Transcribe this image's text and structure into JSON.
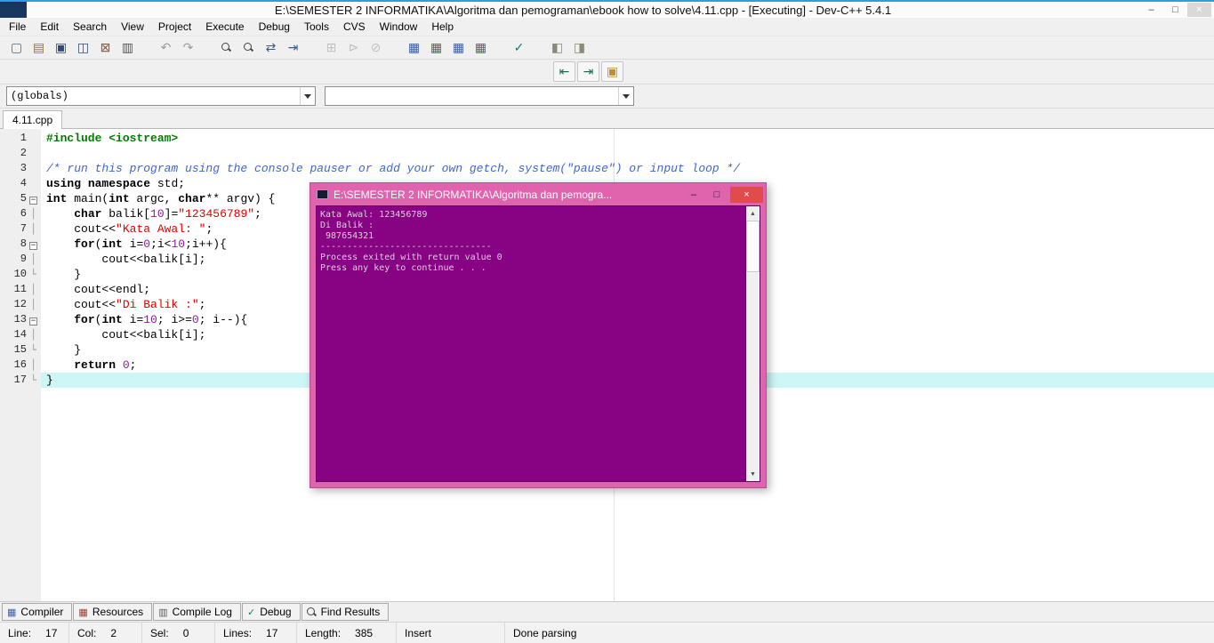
{
  "accent": {
    "top_strip": "#2ba0e0",
    "app_block": "#17375e"
  },
  "window": {
    "title": "E:\\SEMESTER 2 INFORMATIKA\\Algoritma dan pemograman\\ebook how to solve\\4.11.cpp - [Executing] - Dev-C++ 5.4.1",
    "minimize": "–",
    "maximize": "□",
    "close": "×"
  },
  "menubar": {
    "items": [
      "File",
      "Edit",
      "Search",
      "View",
      "Project",
      "Execute",
      "Debug",
      "Tools",
      "CVS",
      "Window",
      "Help"
    ]
  },
  "toolbar_main": {
    "groups": [
      [
        {
          "name": "new-file-icon",
          "glyph": "▢",
          "color": "#4a6a8a"
        },
        {
          "name": "open-file-icon",
          "glyph": "▤",
          "color": "#8a7a3a"
        },
        {
          "name": "save-icon",
          "glyph": "▣",
          "color": "#2e4a7a"
        },
        {
          "name": "save-all-icon",
          "glyph": "◫",
          "color": "#2e4a7a"
        },
        {
          "name": "close-file-icon",
          "glyph": "⊠",
          "color": "#7a5a4a"
        },
        {
          "name": "print-icon",
          "glyph": "▥",
          "color": "#555555"
        }
      ],
      [
        {
          "name": "undo-icon",
          "glyph": "↶",
          "color": "#9a9a9a"
        },
        {
          "name": "redo-icon",
          "glyph": "↷",
          "color": "#9a9a9a"
        }
      ],
      [
        {
          "name": "find-icon",
          "glyph": "MAG",
          "color": "#444444"
        },
        {
          "name": "find-in-files-icon",
          "glyph": "MAG",
          "color": "#444444"
        },
        {
          "name": "replace-icon",
          "glyph": "⇄",
          "color": "#3a5a8a"
        },
        {
          "name": "goto-line-icon",
          "glyph": "⇥",
          "color": "#3a5a8a"
        }
      ],
      [
        {
          "name": "compile-icon",
          "glyph": "⊞",
          "color": "#999999",
          "disabled": true
        },
        {
          "name": "run-icon",
          "glyph": "⊳",
          "color": "#999999",
          "disabled": true
        },
        {
          "name": "compile-run-icon",
          "glyph": "⊘",
          "color": "#999999",
          "disabled": true
        }
      ],
      [
        {
          "name": "rebuild-icon",
          "glyph": "▦",
          "color": "#3f5fa9"
        },
        {
          "name": "debug-icon",
          "glyph": "▦",
          "color": "#3f5fa9"
        },
        {
          "name": "profile-icon",
          "glyph": "▦",
          "color": "#3f5fa9"
        },
        {
          "name": "profiling-log-icon",
          "glyph": "▦",
          "color": "#3f5fa9"
        }
      ],
      [
        {
          "name": "syntax-check-icon",
          "glyph": "✓",
          "color": "#1d7a68"
        }
      ],
      [
        {
          "name": "package-manager-icon",
          "glyph": "◧",
          "color": "#8a8a7a"
        },
        {
          "name": "package-install-icon",
          "glyph": "◨",
          "color": "#8a8a7a"
        }
      ]
    ]
  },
  "toolbar_nav": {
    "groups": [
      [
        {
          "name": "goto-prev-window-icon",
          "glyph": "⇤",
          "color": "#1f6f4f"
        },
        {
          "name": "goto-next-window-icon",
          "glyph": "⇥",
          "color": "#1f6f4f"
        },
        {
          "name": "full-screen-icon",
          "glyph": "▣",
          "color": "#c98a2a"
        }
      ]
    ]
  },
  "navigation": {
    "globals": "(globals)",
    "members": ""
  },
  "tabs": {
    "editor": "4.11.cpp"
  },
  "editor": {
    "highlight_color": "#cdf6f6",
    "lines": [
      {
        "num": 1,
        "fold": "",
        "seg": [
          {
            "c": "p",
            "t": "#include <iostream>"
          }
        ]
      },
      {
        "num": 2,
        "fold": "",
        "seg": []
      },
      {
        "num": 3,
        "fold": "",
        "seg": [
          {
            "c": "c",
            "t": "/* run this program using the console pauser or add your own getch, system(\"pause\") or input loop */"
          }
        ]
      },
      {
        "num": 4,
        "fold": "",
        "seg": [
          {
            "c": "k",
            "t": "using"
          },
          {
            "c": "t",
            "t": " "
          },
          {
            "c": "k",
            "t": "namespace"
          },
          {
            "c": "t",
            "t": " std;"
          }
        ]
      },
      {
        "num": 5,
        "fold": "start",
        "seg": [
          {
            "c": "k",
            "t": "int"
          },
          {
            "c": "t",
            "t": " main("
          },
          {
            "c": "k",
            "t": "int"
          },
          {
            "c": "t",
            "t": " argc, "
          },
          {
            "c": "k",
            "t": "char"
          },
          {
            "c": "t",
            "t": "** argv) {"
          }
        ]
      },
      {
        "num": 6,
        "fold": "line",
        "seg": [
          {
            "c": "t",
            "t": "    "
          },
          {
            "c": "k",
            "t": "char"
          },
          {
            "c": "t",
            "t": " balik["
          },
          {
            "c": "n",
            "t": "10"
          },
          {
            "c": "t",
            "t": "]="
          },
          {
            "c": "s",
            "t": "\"123456789\""
          },
          {
            "c": "t",
            "t": ";"
          }
        ]
      },
      {
        "num": 7,
        "fold": "line",
        "seg": [
          {
            "c": "t",
            "t": "    cout<<"
          },
          {
            "c": "s",
            "t": "\"Kata Awal: \""
          },
          {
            "c": "t",
            "t": ";"
          }
        ]
      },
      {
        "num": 8,
        "fold": "start",
        "seg": [
          {
            "c": "t",
            "t": "    "
          },
          {
            "c": "k",
            "t": "for"
          },
          {
            "c": "t",
            "t": "("
          },
          {
            "c": "k",
            "t": "int"
          },
          {
            "c": "t",
            "t": " i="
          },
          {
            "c": "n",
            "t": "0"
          },
          {
            "c": "t",
            "t": ";i<"
          },
          {
            "c": "n",
            "t": "10"
          },
          {
            "c": "t",
            "t": ";i++){"
          }
        ]
      },
      {
        "num": 9,
        "fold": "line",
        "seg": [
          {
            "c": "t",
            "t": "        cout<<balik[i];"
          }
        ]
      },
      {
        "num": 10,
        "fold": "end",
        "seg": [
          {
            "c": "t",
            "t": "    }"
          }
        ]
      },
      {
        "num": 11,
        "fold": "line",
        "seg": [
          {
            "c": "t",
            "t": "    cout<<endl;"
          }
        ]
      },
      {
        "num": 12,
        "fold": "line",
        "seg": [
          {
            "c": "t",
            "t": "    cout<<"
          },
          {
            "c": "s",
            "t": "\"Di Balik :\""
          },
          {
            "c": "t",
            "t": ";"
          }
        ]
      },
      {
        "num": 13,
        "fold": "start",
        "seg": [
          {
            "c": "t",
            "t": "    "
          },
          {
            "c": "k",
            "t": "for"
          },
          {
            "c": "t",
            "t": "("
          },
          {
            "c": "k",
            "t": "int"
          },
          {
            "c": "t",
            "t": " i="
          },
          {
            "c": "n",
            "t": "10"
          },
          {
            "c": "t",
            "t": "; i>="
          },
          {
            "c": "n",
            "t": "0"
          },
          {
            "c": "t",
            "t": "; i--){"
          }
        ]
      },
      {
        "num": 14,
        "fold": "line",
        "seg": [
          {
            "c": "t",
            "t": "        cout<<balik[i];"
          }
        ]
      },
      {
        "num": 15,
        "fold": "end",
        "seg": [
          {
            "c": "t",
            "t": "    }"
          }
        ]
      },
      {
        "num": 16,
        "fold": "line",
        "seg": [
          {
            "c": "t",
            "t": "    "
          },
          {
            "c": "k",
            "t": "return"
          },
          {
            "c": "t",
            "t": " "
          },
          {
            "c": "n",
            "t": "0"
          },
          {
            "c": "t",
            "t": ";"
          }
        ]
      },
      {
        "num": 17,
        "fold": "end",
        "highlight": true,
        "seg": [
          {
            "c": "t",
            "t": "}"
          }
        ]
      }
    ]
  },
  "console": {
    "title": "E:\\SEMESTER 2 INFORMATIKA\\Algoritma dan pemogra...",
    "minimize": "–",
    "maximize": "□",
    "close": "×",
    "frame_color": "#df63ad",
    "body_color": "#870383",
    "close_color": "#e14b4b",
    "scroll_up": "▲",
    "scroll_down": "▼",
    "lines": [
      "Kata Awal: 123456789",
      "Di Balik :",
      " 987654321",
      "--------------------------------",
      "Process exited with return value 0",
      "Press any key to continue . . ."
    ]
  },
  "bottom_tabs": [
    {
      "name": "tab-compiler",
      "icon": "compiler-grid-icon",
      "glyph": "▦",
      "color": "#3f5fa9",
      "label": "Compiler"
    },
    {
      "name": "tab-resources",
      "icon": "resources-grid-icon",
      "glyph": "▦",
      "color": "#a03a30",
      "label": "Resources"
    },
    {
      "name": "tab-compile-log",
      "icon": "compile-log-icon",
      "glyph": "▥",
      "color": "#5a5a5a",
      "label": "Compile Log"
    },
    {
      "name": "tab-debug",
      "icon": "debug-check-icon",
      "glyph": "✓",
      "color": "#1d7a68",
      "label": "Debug"
    },
    {
      "name": "tab-find-results",
      "icon": "find-results-icon",
      "glyph": "MAG",
      "color": "#444444",
      "label": "Find Results"
    }
  ],
  "statusbar": {
    "segments": [
      {
        "key": "line",
        "label": "Line:",
        "value": "17",
        "w": 78
      },
      {
        "key": "col",
        "label": "Col:",
        "value": "2",
        "w": 82
      },
      {
        "key": "sel",
        "label": "Sel:",
        "value": "0",
        "w": 82
      },
      {
        "key": "lines",
        "label": "Lines:",
        "value": "17",
        "w": 92
      },
      {
        "key": "length",
        "label": "Length:",
        "value": "385",
        "w": 112
      },
      {
        "key": "mode",
        "label": "Insert",
        "value": "",
        "w": 122
      },
      {
        "key": "parse-status",
        "label": "Done parsing",
        "value": "",
        "w": 0
      }
    ]
  }
}
